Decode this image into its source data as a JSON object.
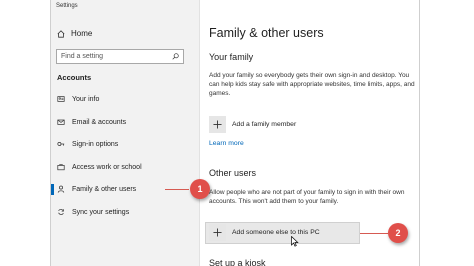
{
  "window": {
    "title": "Settings"
  },
  "sidebar": {
    "home_label": "Home",
    "search_placeholder": "Find a setting",
    "section_label": "Accounts",
    "items": [
      {
        "label": "Your info",
        "icon": "person-card-icon"
      },
      {
        "label": "Email & accounts",
        "icon": "envelope-icon"
      },
      {
        "label": "Sign-in options",
        "icon": "key-icon"
      },
      {
        "label": "Access work or school",
        "icon": "briefcase-icon"
      },
      {
        "label": "Family & other users",
        "icon": "person-icon",
        "selected": true
      },
      {
        "label": "Sync your settings",
        "icon": "sync-icon"
      }
    ]
  },
  "content": {
    "title": "Family & other users",
    "your_family": {
      "heading": "Your family",
      "description": "Add your family so everybody gets their own sign-in and desktop. You can help kids stay safe with appropriate websites, time limits, apps, and games.",
      "add_label": "Add a family member",
      "learn_more": "Learn more"
    },
    "other_users": {
      "heading": "Other users",
      "description": "Allow people who are not part of your family to sign in with their own accounts. This won't add them to your family.",
      "add_label": "Add someone else to this PC"
    },
    "kiosk_heading": "Set up a kiosk"
  },
  "annotations": {
    "badge1": "1",
    "badge2": "2",
    "badge_color": "#e04f4a"
  },
  "colors": {
    "accent": "#0067b8",
    "sidebar_bg": "#f2f2f2"
  }
}
